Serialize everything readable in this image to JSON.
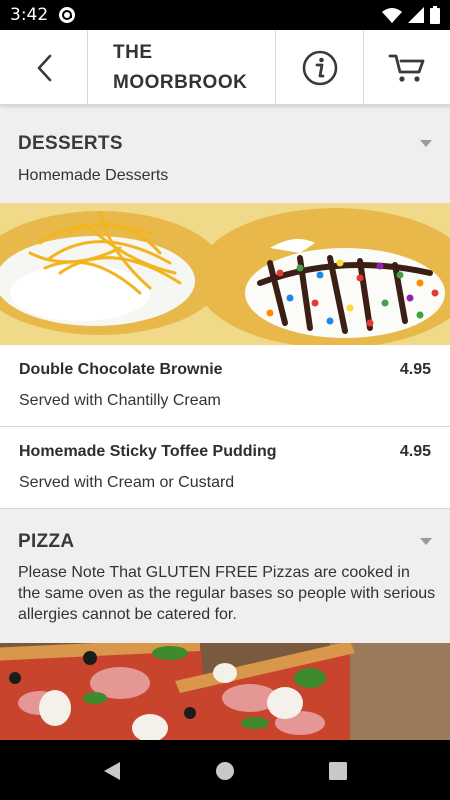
{
  "status": {
    "time": "3:42",
    "app_icon": "at-sign-icon",
    "icons": [
      "wifi-icon",
      "signal-icon",
      "battery-icon"
    ]
  },
  "header": {
    "back_icon": "chevron-left-icon",
    "title_line1": "THE",
    "title_line2": "MOORBROOK",
    "info_icon": "info-icon",
    "cart_icon": "cart-icon"
  },
  "categories": [
    {
      "title": "DESSERTS",
      "description": "Homemade Desserts",
      "image": "desserts-photo",
      "items": [
        {
          "name": "Double Chocolate Brownie",
          "price": "4.95",
          "description": "Served with Chantilly Cream"
        },
        {
          "name": "Homemade Sticky Toffee Pudding",
          "price": "4.95",
          "description": "Served with Cream or Custard"
        }
      ]
    },
    {
      "title": "PIZZA",
      "description": "Please Note That GLUTEN FREE Pizzas are cooked in the same oven as the regular bases so people with serious allergies cannot be catered for.",
      "image": "pizza-photo"
    }
  ],
  "nav": {
    "icons": [
      "back-triangle-icon",
      "home-circle-icon",
      "recents-square-icon"
    ]
  },
  "colors": {
    "status_bar": "#000000",
    "header_bg": "#ffffff",
    "category_bg": "#efefef",
    "text": "#333333"
  }
}
